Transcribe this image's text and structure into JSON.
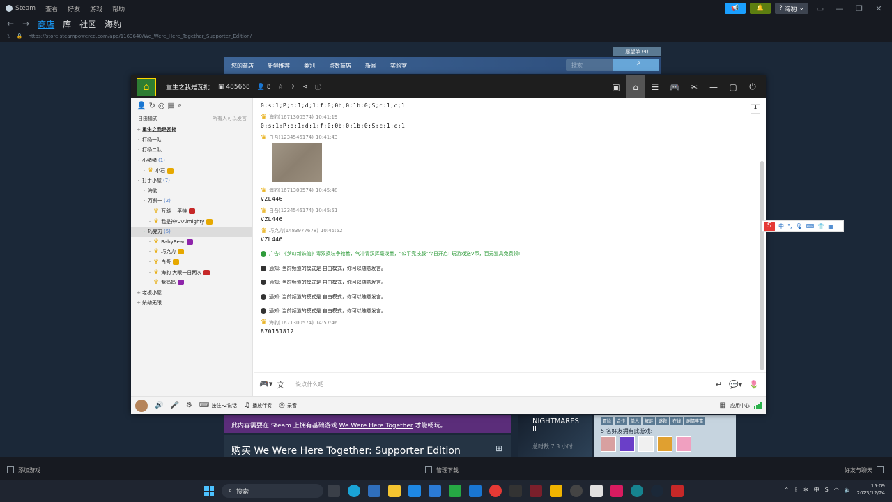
{
  "steam": {
    "brand": "Steam",
    "menu": [
      "查看",
      "好友",
      "游戏",
      "帮助"
    ],
    "user": "海豹",
    "nav_tabs": [
      {
        "label": "商店",
        "active": true
      },
      {
        "label": "库",
        "active": false
      },
      {
        "label": "社区",
        "active": false
      },
      {
        "label": "海豹",
        "active": false
      }
    ],
    "url": "https://store.steampowered.com/app/1163640/We_Were_Here_Together_Supporter_Edition/",
    "bottom_add": "添加游戏",
    "bottom_downloads": "管理下载",
    "bottom_friends": "好友与聊天"
  },
  "store": {
    "wishlist": "愿望单 (4)",
    "nav": [
      "您的商店",
      "新鲜推荐",
      "类别",
      "点数商店",
      "新闻",
      "实验室"
    ],
    "search_placeholder": "搜索",
    "dlc_notice_prefix": "此内容需要在 Steam 上拥有基础游戏 ",
    "dlc_game": "We Were Here Together",
    "dlc_notice_suffix": " 才能畅玩。",
    "buy_title": "购买 We Were Here Together: Supporter Edition",
    "thumb_title": "NIGHTMARES II",
    "thumb_sub": "总时数 7.3 小时",
    "tags": [
      "冒险",
      "合作",
      "单人",
      "解谜",
      "谜题",
      "在线",
      "剧情丰富"
    ],
    "friends_line": "5 名好友拥有此游戏:"
  },
  "qq": {
    "channel_name": "重生之我是瓦批",
    "member_count": "485668",
    "online": "8",
    "side_header": "自由模式",
    "side_header_right": "所有人可以发言",
    "tree": [
      {
        "label": "重生之我是瓦批",
        "exp": "+",
        "level": 0,
        "bold": true
      },
      {
        "label": "打杨一队",
        "exp": "·",
        "level": 0
      },
      {
        "label": "打杨二队",
        "exp": "·",
        "level": 0
      },
      {
        "label": "小猪猪",
        "count": "(1)",
        "exp": "-",
        "level": 0
      },
      {
        "label": "小石",
        "exp": "·",
        "level": 1,
        "crown": true,
        "badge": "#e6a800"
      },
      {
        "label": "打手小屋",
        "count": "(7)",
        "exp": "-",
        "level": 0
      },
      {
        "label": "海豹",
        "exp": "·",
        "level": 1
      },
      {
        "label": "万斜一",
        "count": "(2)",
        "exp": "-",
        "level": 1
      },
      {
        "label": "万斜一 平特",
        "exp": "·",
        "level": 2,
        "crown": true,
        "badge": "#c62828"
      },
      {
        "label": "我是神AAAlmighty",
        "exp": "·",
        "level": 2,
        "crown": true,
        "badge": "#e6a800"
      },
      {
        "label": "巧克力",
        "count": "(5)",
        "exp": "-",
        "level": 1,
        "selected": true
      },
      {
        "label": "BabyBear",
        "exp": "·",
        "level": 2,
        "crown": true,
        "badge": "#8e24aa"
      },
      {
        "label": "巧克力",
        "exp": "·",
        "level": 2,
        "crown": true,
        "badge": "#e6a800"
      },
      {
        "label": "白吾",
        "exp": "·",
        "level": 2,
        "crown": true,
        "badge": "#e6a800"
      },
      {
        "label": "海豹 大眼一日两次",
        "exp": "·",
        "level": 2,
        "crown": true,
        "badge": "#c62828"
      },
      {
        "label": "紫妈妈",
        "exp": "·",
        "level": 2,
        "crown": true,
        "badge": "#8e24aa"
      },
      {
        "label": "老板小屋",
        "exp": "+",
        "level": 0
      },
      {
        "label": "杀劫无限",
        "exp": "+",
        "level": 0
      }
    ],
    "messages": [
      {
        "type": "text",
        "sender": "",
        "time": "",
        "text": "0;s:1;P;o:1;d;1:f;0;0b;0:1b:0;S;c:1;c;1"
      },
      {
        "type": "text",
        "sender": "海豹(1671300574)",
        "time": "10:41:19",
        "text": "0;s:1;P;o:1;d;1:f;0;0b;0:1b:0;S;c:1;c;1"
      },
      {
        "type": "image",
        "sender": "白吾(1234546174)",
        "time": "10:41:43",
        "text": ""
      },
      {
        "type": "text",
        "sender": "海豹(1671300574)",
        "time": "10:45:48",
        "text": "VZL446"
      },
      {
        "type": "text",
        "sender": "白吾(1234546174)",
        "time": "10:45:51",
        "text": "VZL446"
      },
      {
        "type": "text",
        "sender": "巧克力(1483977678)",
        "time": "10:45:52",
        "text": "VZL446"
      }
    ],
    "ad": "广告: 《梦幻新诛仙》毒双换装争抢着，气冲青汉挥毫泼墨，“公平竞技服”今日开启! 玩游戏送V币，百元道具免费领!",
    "notices": [
      "通知: 当前频道的模式是 自由模式，你可以随意发言。",
      "通知: 当前频道的模式是 自由模式，你可以随意发言。",
      "通知: 当前频道的模式是 自由模式，你可以随意发言。",
      "通知: 当前频道的模式是 自由模式，你可以随意发言。"
    ],
    "last_msg": {
      "sender": "海豹(1671300574)",
      "time": "14:57:46",
      "text": "870151812"
    },
    "input_placeholder": "说点什么吧...",
    "bottom": {
      "ptt": "按住F2说话",
      "music": "播放伴奏",
      "record": "录音",
      "apps": "应用中心"
    }
  },
  "ime": {
    "label": "中"
  },
  "taskbar": {
    "search": "搜索",
    "time": "15:09",
    "date": "2023/12/24"
  }
}
